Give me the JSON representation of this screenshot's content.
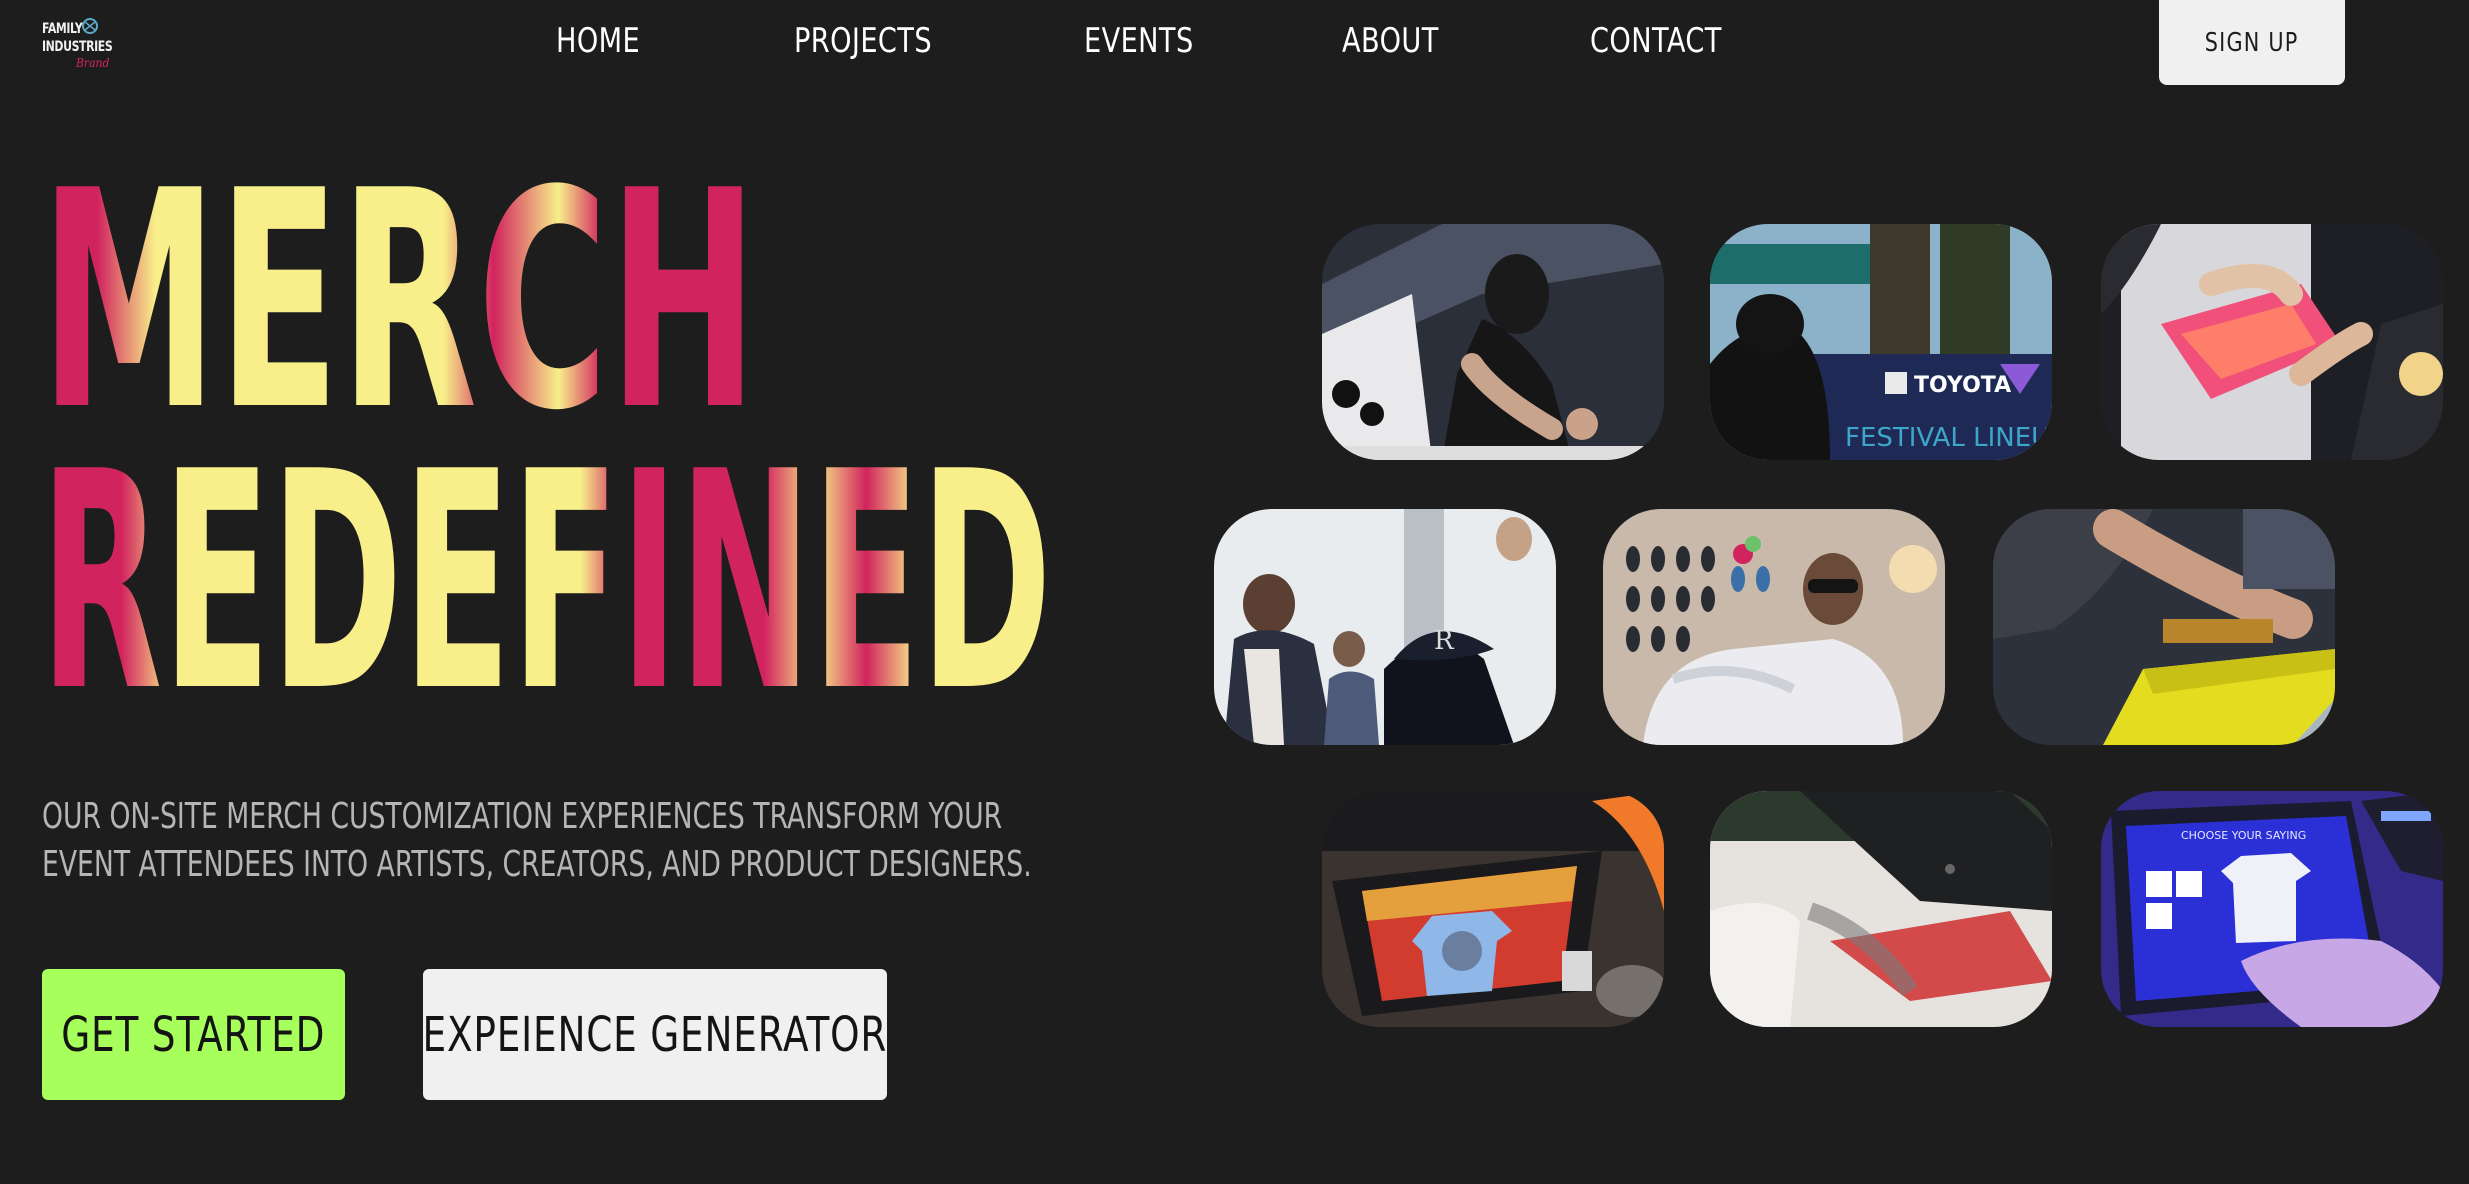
{
  "logo": {
    "line1": "FAMILY",
    "line2": "INDUSTRIES",
    "accent": "Brand"
  },
  "nav": {
    "links": [
      "HOME",
      "PROJECTS",
      "EVENTS",
      "ABOUT",
      "CONTACT"
    ],
    "signup_label": "SIGN UP"
  },
  "hero": {
    "headline_line1": "MERCH",
    "headline_line2": "REDEFINED",
    "subtitle_line1": "OUR ON-SITE MERCH CUSTOMIZATION EXPERIENCES TRANSFORM YOUR",
    "subtitle_line2": "EVENT ATTENDEES INTO ARTISTS, CREATORS, AND PRODUCT DESIGNERS.",
    "primary_cta": "GET STARTED",
    "secondary_cta": "EXPEIENCE GENERATOR"
  },
  "gallery": {
    "photos": [
      {
        "name": "photo-screen-printer-artist"
      },
      {
        "name": "photo-festival-lineup-booth",
        "sign_brand": "TOYOTA",
        "sign_text": "FESTIVAL LINEUP"
      },
      {
        "name": "photo-pink-squeegee"
      },
      {
        "name": "photo-attendees-crowd"
      },
      {
        "name": "photo-merch-display-wall"
      },
      {
        "name": "photo-yellow-ink-print"
      },
      {
        "name": "photo-design-kiosk-screen"
      },
      {
        "name": "photo-heat-press"
      },
      {
        "name": "photo-touchscreen-choose",
        "screen_text": "CHOOSE YOUR SAYING"
      }
    ]
  },
  "colors": {
    "background": "#1d1d1d",
    "headline_yellow": "#f8ef8a",
    "headline_magenta": "#d1245e",
    "accent_green": "#a6ff5a",
    "button_light": "#f0f0f0",
    "subtitle_gray": "#b5b5b5"
  }
}
